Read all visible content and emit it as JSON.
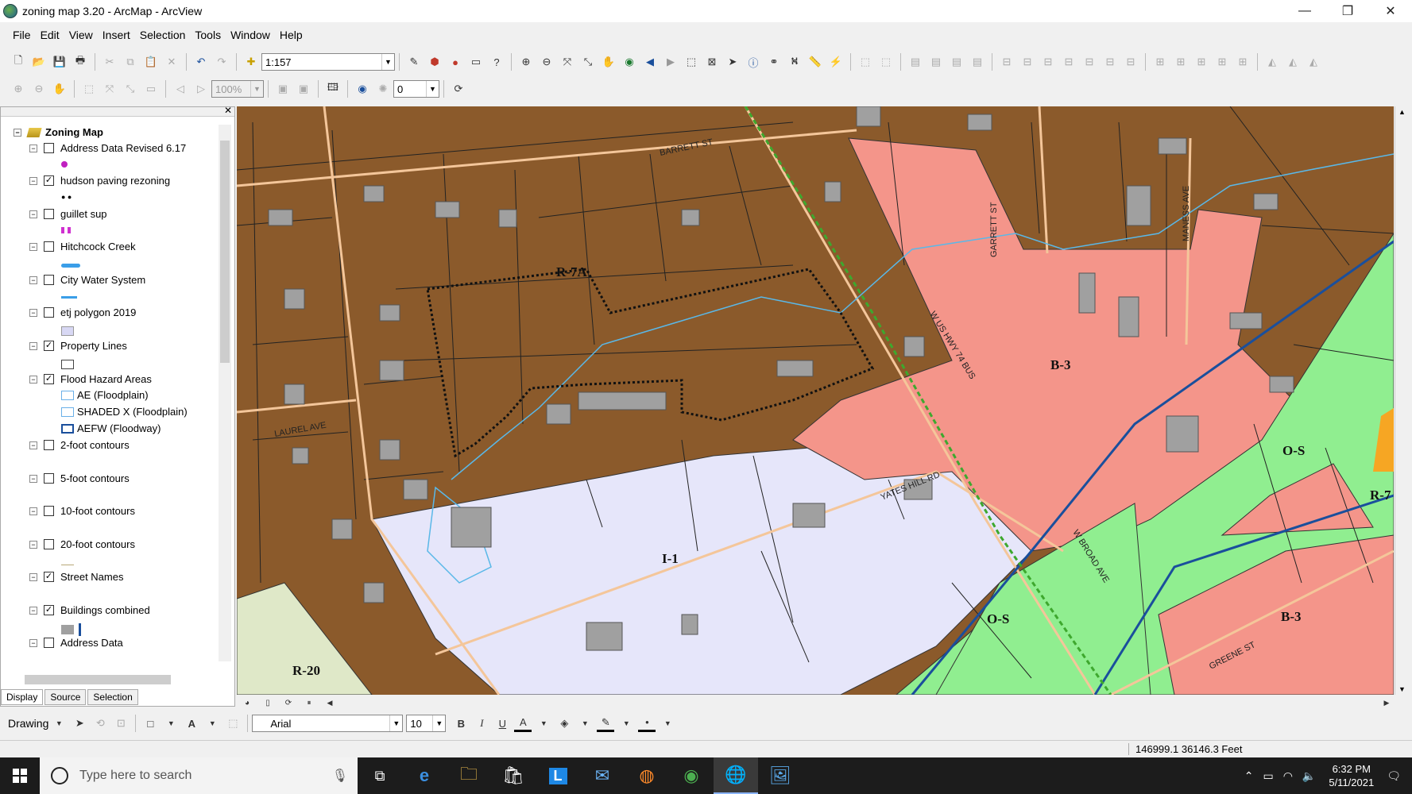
{
  "window": {
    "title": "zoning map 3.20 - ArcMap - ArcView",
    "minimize": "—",
    "restore": "❐",
    "close": "✕"
  },
  "menu": [
    "File",
    "Edit",
    "View",
    "Insert",
    "Selection",
    "Tools",
    "Window",
    "Help"
  ],
  "toolbar": {
    "scale_value": "1:157",
    "zoom_value": "100%",
    "angle_value": "0"
  },
  "toc": {
    "root": "Zoning Map",
    "layers": [
      {
        "label": "Address Data Revised 6.17",
        "checked": false
      },
      {
        "label": "hudson paving rezoning",
        "checked": true
      },
      {
        "label": "guillet sup",
        "checked": false
      },
      {
        "label": "Hitchcock Creek",
        "checked": false
      },
      {
        "label": "City Water System",
        "checked": false
      },
      {
        "label": "etj polygon 2019",
        "checked": false
      },
      {
        "label": "Property Lines",
        "checked": true
      },
      {
        "label": "Flood Hazard Areas",
        "checked": true
      },
      {
        "label": "2-foot contours",
        "checked": false
      },
      {
        "label": "5-foot contours",
        "checked": false
      },
      {
        "label": "10-foot contours",
        "checked": false
      },
      {
        "label": "20-foot contours",
        "checked": false
      },
      {
        "label": "Street Names",
        "checked": true
      },
      {
        "label": "Buildings combined",
        "checked": true
      },
      {
        "label": "Address Data",
        "checked": false
      }
    ],
    "flood_legend": [
      "AE (Floodplain)",
      "SHADED X (Floodplain)",
      "AEFW (Floodway)"
    ],
    "tabs": [
      "Display",
      "Source",
      "Selection"
    ]
  },
  "map": {
    "zone_labels": [
      "R-7A",
      "B-3",
      "O-S",
      "R-7",
      "I-1",
      "O-S",
      "B-3",
      "R-20"
    ],
    "street_labels": [
      "BARRETT ST",
      "GARRETT ST",
      "MANESS AVE",
      "W US HWY 74 BUS",
      "LAUREL AVE",
      "YATES HILL RD",
      "W BROAD AVE",
      "GREENE ST"
    ],
    "colors": {
      "residential": "#8b5a2b",
      "business": "#f4958a",
      "open_space": "#90ee90",
      "industrial": "#e6e6fa",
      "r20": "#dfe8c8",
      "building": "#a0a0a0"
    }
  },
  "drawing": {
    "label": "Drawing",
    "font": "Arial",
    "size": "10",
    "bold": "B",
    "italic": "I",
    "underline": "U"
  },
  "status": {
    "coords": "146999.1  36146.3 Feet"
  },
  "taskbar": {
    "search_placeholder": "Type here to search",
    "time": "6:32 PM",
    "date": "5/11/2021"
  }
}
